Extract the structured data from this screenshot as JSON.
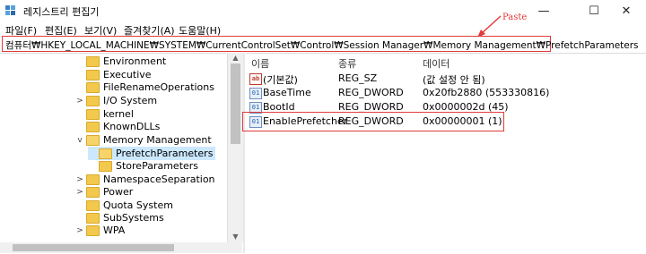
{
  "window": {
    "title": "레지스트리 편집기",
    "minimize": "—",
    "maximize": "☐",
    "close": "✕"
  },
  "menu": [
    "파일(F)",
    "편집(E)",
    "보기(V)",
    "즐겨찾기(A)",
    "도움말(H)"
  ],
  "address": {
    "path": "컴퓨터₩HKEY_LOCAL_MACHINE₩SYSTEM₩CurrentControlSet₩Control₩Session Manager₩Memory Management₩PrefetchParameters"
  },
  "annotation": {
    "text": "Paste",
    "color": "#e23b3b"
  },
  "tree": [
    {
      "label": "Environment",
      "chev": ""
    },
    {
      "label": "Executive",
      "chev": ""
    },
    {
      "label": "FileRenameOperations",
      "chev": ""
    },
    {
      "label": "I/O System",
      "chev": ">"
    },
    {
      "label": "kernel",
      "chev": ""
    },
    {
      "label": "KnownDLLs",
      "chev": ""
    },
    {
      "label": "Memory Management",
      "chev": "v"
    },
    {
      "label": "PrefetchParameters",
      "chev": ""
    },
    {
      "label": "StoreParameters",
      "chev": ""
    },
    {
      "label": "NamespaceSeparation",
      "chev": ">"
    },
    {
      "label": "Power",
      "chev": ">"
    },
    {
      "label": "Quota System",
      "chev": ""
    },
    {
      "label": "SubSystems",
      "chev": ""
    },
    {
      "label": "WPA",
      "chev": ">"
    }
  ],
  "columns": {
    "name": "이름",
    "type": "종류",
    "data": "데이터"
  },
  "values": [
    {
      "icon": "ab",
      "name": "(기본값)",
      "type": "REG_SZ",
      "data": "(값 설정 안 됨)"
    },
    {
      "icon": "bin",
      "name": "BaseTime",
      "type": "REG_DWORD",
      "data": "0x20fb2880 (553330816)"
    },
    {
      "icon": "bin",
      "name": "BootId",
      "type": "REG_DWORD",
      "data": "0x0000002d (45)"
    },
    {
      "icon": "bin",
      "name": "EnablePrefetcher",
      "type": "REG_DWORD",
      "data": "0x00000001 (1)"
    }
  ]
}
